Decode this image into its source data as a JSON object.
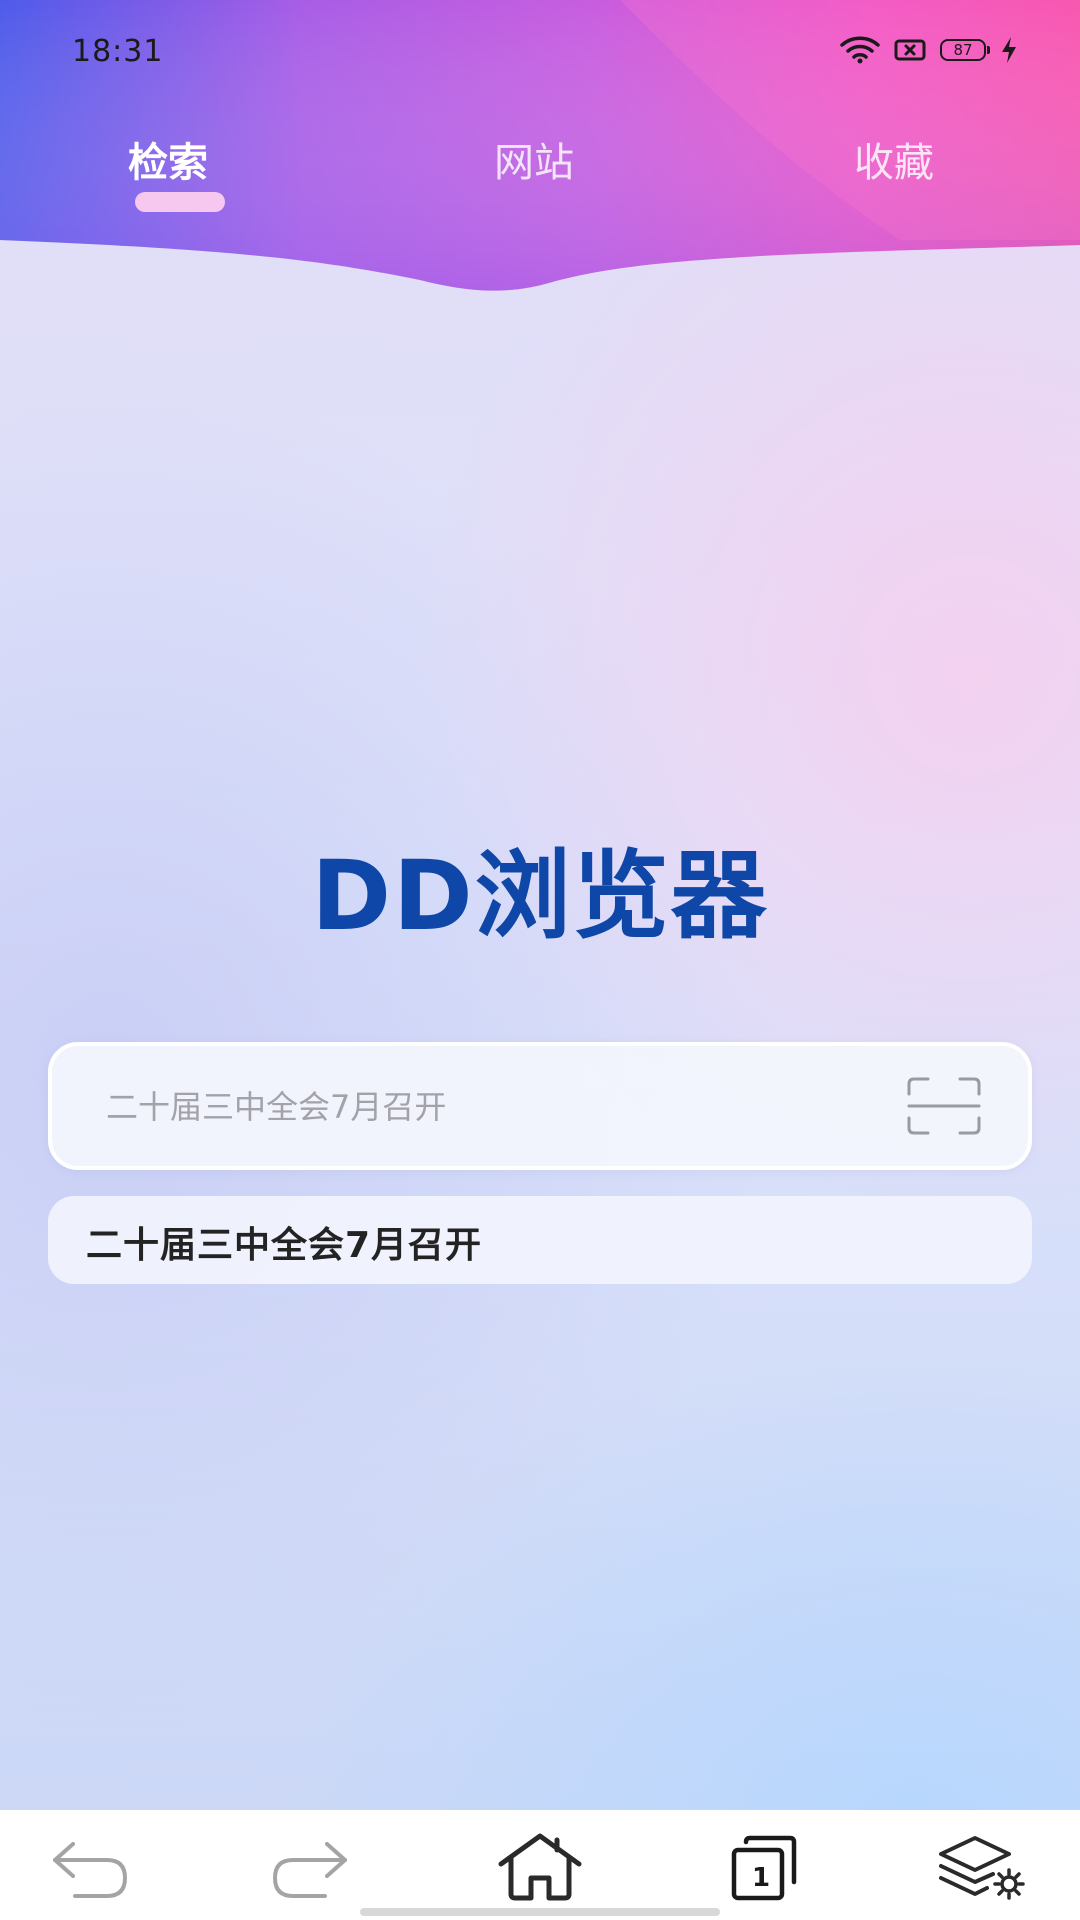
{
  "status_bar": {
    "time": "18:31",
    "battery_level": "87",
    "icons": [
      "wifi-icon",
      "sim-no-signal-icon",
      "battery-icon",
      "charging-icon"
    ]
  },
  "tabs": [
    {
      "label": "检索",
      "active": true
    },
    {
      "label": "网站",
      "active": false
    },
    {
      "label": "收藏",
      "active": false
    }
  ],
  "logo": {
    "title": "DD浏览器",
    "color": "#0e47a8"
  },
  "search": {
    "placeholder": "二十届三中全会7月召开",
    "value": "",
    "icon": "scan-icon"
  },
  "suggestions": [
    "二十届三中全会7月召开"
  ],
  "bottom_nav": {
    "items": [
      "back-icon",
      "forward-icon",
      "home-icon",
      "tabs-icon",
      "layers-settings-icon"
    ],
    "tab_count": "1"
  },
  "colors": {
    "header_gradient": [
      "#5a58ec",
      "#b75be3",
      "#ef4ab8"
    ],
    "tab_indicator": "#f6c8ef",
    "background": "#dde3fb"
  }
}
